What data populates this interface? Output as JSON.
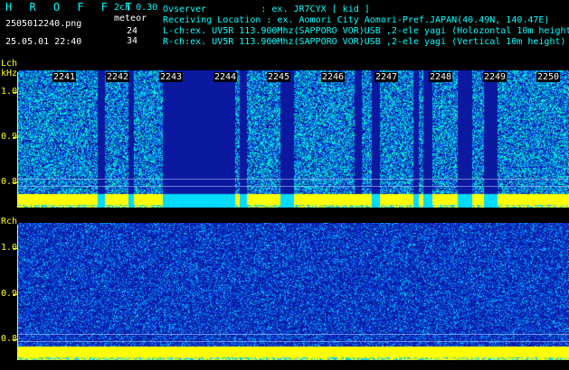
{
  "app": {
    "brand": "H R O F F T",
    "version": "2ch 0.30",
    "mode": "meteor",
    "filename": "2505012240.png",
    "datetime": "25.05.01 22:40",
    "lch_count": "24",
    "rch_count": "34"
  },
  "info": {
    "observer": "Ovserver          : ex. JR7CYX [ kid ]",
    "location": "Receiving Location : ex. Aomori City Aomori-Pref.JAPAN(40.49N, 140.47E)",
    "lch": "L-ch:ex. UV5R 113.900Mhz(SAPPORO VOR)USB ,2-ele yagi (Holozontal 10m height",
    "rch": "R-ch:ex. UV5R 113.900Mhz(SAPPORO VOR)USB ,2-ele yagi (Vertical 10m height)"
  },
  "left_channel": {
    "label": "Lch",
    "unit": "kHz",
    "y_ticks": [
      "1.0",
      "0.9",
      "0.8"
    ],
    "time_labels": [
      "2241",
      "2242",
      "2243",
      "2244",
      "2245",
      "2246",
      "2247",
      "2248",
      "2249",
      "2250"
    ]
  },
  "right_channel": {
    "label": "Rch",
    "y_ticks": [
      "1.0",
      "0.9",
      "0.8"
    ]
  },
  "colors": {
    "background": "#000000",
    "header_cyan": "#00ffff",
    "axis_yellow": "#ffff00",
    "waterfall_low": "#0a1aa0",
    "waterfall_high": "#00ffcc"
  }
}
